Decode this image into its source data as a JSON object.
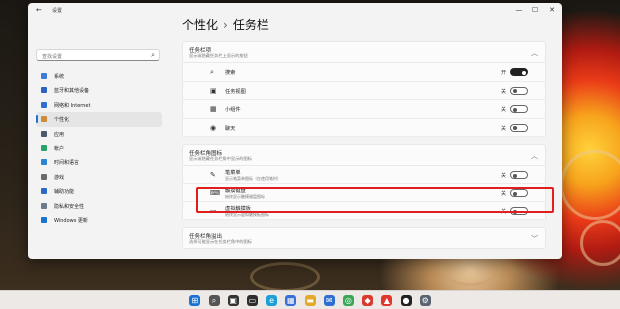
{
  "window": {
    "title": "设置",
    "minimize": "—",
    "maximize": "☐",
    "close": "✕"
  },
  "search": {
    "placeholder": "查找设置"
  },
  "sidebar": {
    "items": [
      {
        "label": "系统",
        "icon": "monitor-icon",
        "color": "#3d7bd6"
      },
      {
        "label": "蓝牙和其他设备",
        "icon": "bluetooth-icon",
        "color": "#2b62c4"
      },
      {
        "label": "网络和 Internet",
        "icon": "wifi-icon",
        "color": "#2f6fd1"
      },
      {
        "label": "个性化",
        "icon": "brush-icon",
        "color": "#d08a3a"
      },
      {
        "label": "应用",
        "icon": "apps-icon",
        "color": "#4a5a6b"
      },
      {
        "label": "帐户",
        "icon": "person-icon",
        "color": "#2aa36b"
      },
      {
        "label": "时间和语言",
        "icon": "clock-icon",
        "color": "#2c84d6"
      },
      {
        "label": "游戏",
        "icon": "game-icon",
        "color": "#6a6a6a"
      },
      {
        "label": "辅助功能",
        "icon": "accessibility-icon",
        "color": "#2a6ac4"
      },
      {
        "label": "隐私和安全性",
        "icon": "shield-icon",
        "color": "#6a7b8b"
      },
      {
        "label": "Windows 更新",
        "icon": "update-icon",
        "color": "#1a73d1"
      }
    ],
    "active_index": 3
  },
  "header": {
    "parent": "个性化",
    "separator": "›",
    "current": "任务栏"
  },
  "taskbar_items_group": {
    "title": "任务栏项",
    "subtitle": "显示或隐藏任务栏上显示的按钮",
    "items": [
      {
        "label": "搜索",
        "icon": "search-icon",
        "state": "开",
        "on": true
      },
      {
        "label": "任务视图",
        "icon": "task-view-icon",
        "state": "关",
        "on": false
      },
      {
        "label": "小组件",
        "icon": "widgets-icon",
        "state": "关",
        "on": false
      },
      {
        "label": "聊天",
        "icon": "chat-icon",
        "state": "关",
        "on": false
      }
    ]
  },
  "corner_icons_group": {
    "title": "任务栏角图标",
    "subtitle": "显示或隐藏任务栏角中显示的图标",
    "items": [
      {
        "label": "笔菜单",
        "sub": "显示笔菜单图标（在使用笔时）",
        "icon": "pen-icon",
        "state": "关",
        "on": false
      },
      {
        "label": "触摸键盘",
        "sub": "始终显示触摸键盘图标",
        "icon": "keyboard-icon",
        "state": "关",
        "on": false
      },
      {
        "label": "虚拟触摸板",
        "sub": "始终显示虚拟触摸板图标",
        "icon": "touchpad-icon",
        "state": "关",
        "on": false
      }
    ]
  },
  "overflow_group": {
    "title": "任务栏角溢出",
    "subtitle": "选择可能显示在任务栏角中的图标"
  },
  "taskbar": {
    "icons": [
      {
        "name": "start-icon",
        "glyph": "⊞",
        "color": "#1a73d1"
      },
      {
        "name": "search-icon",
        "glyph": "⌕",
        "color": "#555555"
      },
      {
        "name": "task-view-icon",
        "glyph": "▣",
        "color": "#333333"
      },
      {
        "name": "terminal-icon",
        "glyph": "▭",
        "color": "#2d2d2d"
      },
      {
        "name": "edge-icon",
        "glyph": "e",
        "color": "#1f9fd8"
      },
      {
        "name": "store-icon",
        "glyph": "▦",
        "color": "#3a6fd8"
      },
      {
        "name": "explorer-icon",
        "glyph": "▬",
        "color": "#e3a927"
      },
      {
        "name": "mail-icon",
        "glyph": "✉",
        "color": "#2f6fd1"
      },
      {
        "name": "chrome-icon",
        "glyph": "◎",
        "color": "#3aa757"
      },
      {
        "name": "app-red-icon",
        "glyph": "◆",
        "color": "#d93a2e"
      },
      {
        "name": "app-red2-icon",
        "glyph": "▲",
        "color": "#e0362b"
      },
      {
        "name": "app-dark-icon",
        "glyph": "●",
        "color": "#222222"
      },
      {
        "name": "settings-icon",
        "glyph": "⚙",
        "color": "#5a6470"
      }
    ]
  }
}
